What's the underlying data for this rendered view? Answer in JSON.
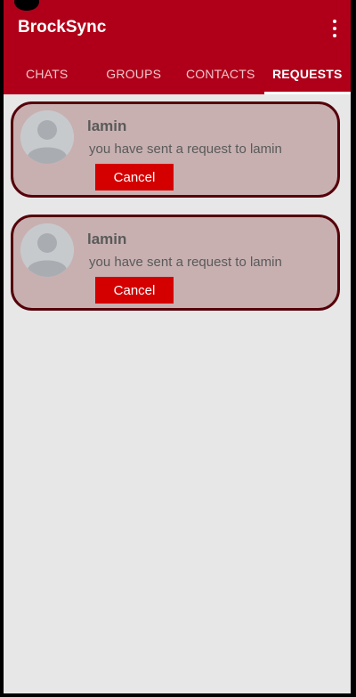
{
  "app": {
    "title": "BrockSync"
  },
  "tabs": [
    {
      "label": "CHATS"
    },
    {
      "label": "GROUPS"
    },
    {
      "label": "CONTACTS"
    },
    {
      "label": "REQUESTS"
    }
  ],
  "active_tab": "REQUESTS",
  "requests": [
    {
      "name": "lamin",
      "message": "you have sent a request to lamin",
      "button": "Cancel"
    },
    {
      "name": "lamin",
      "message": "you have sent a request to lamin",
      "button": "Cancel"
    }
  ],
  "colors": {
    "appbar": "#b00019",
    "background": "#e7e7e7",
    "card": "#c8b0b1",
    "card_border": "#55000a",
    "button": "#d40000"
  }
}
